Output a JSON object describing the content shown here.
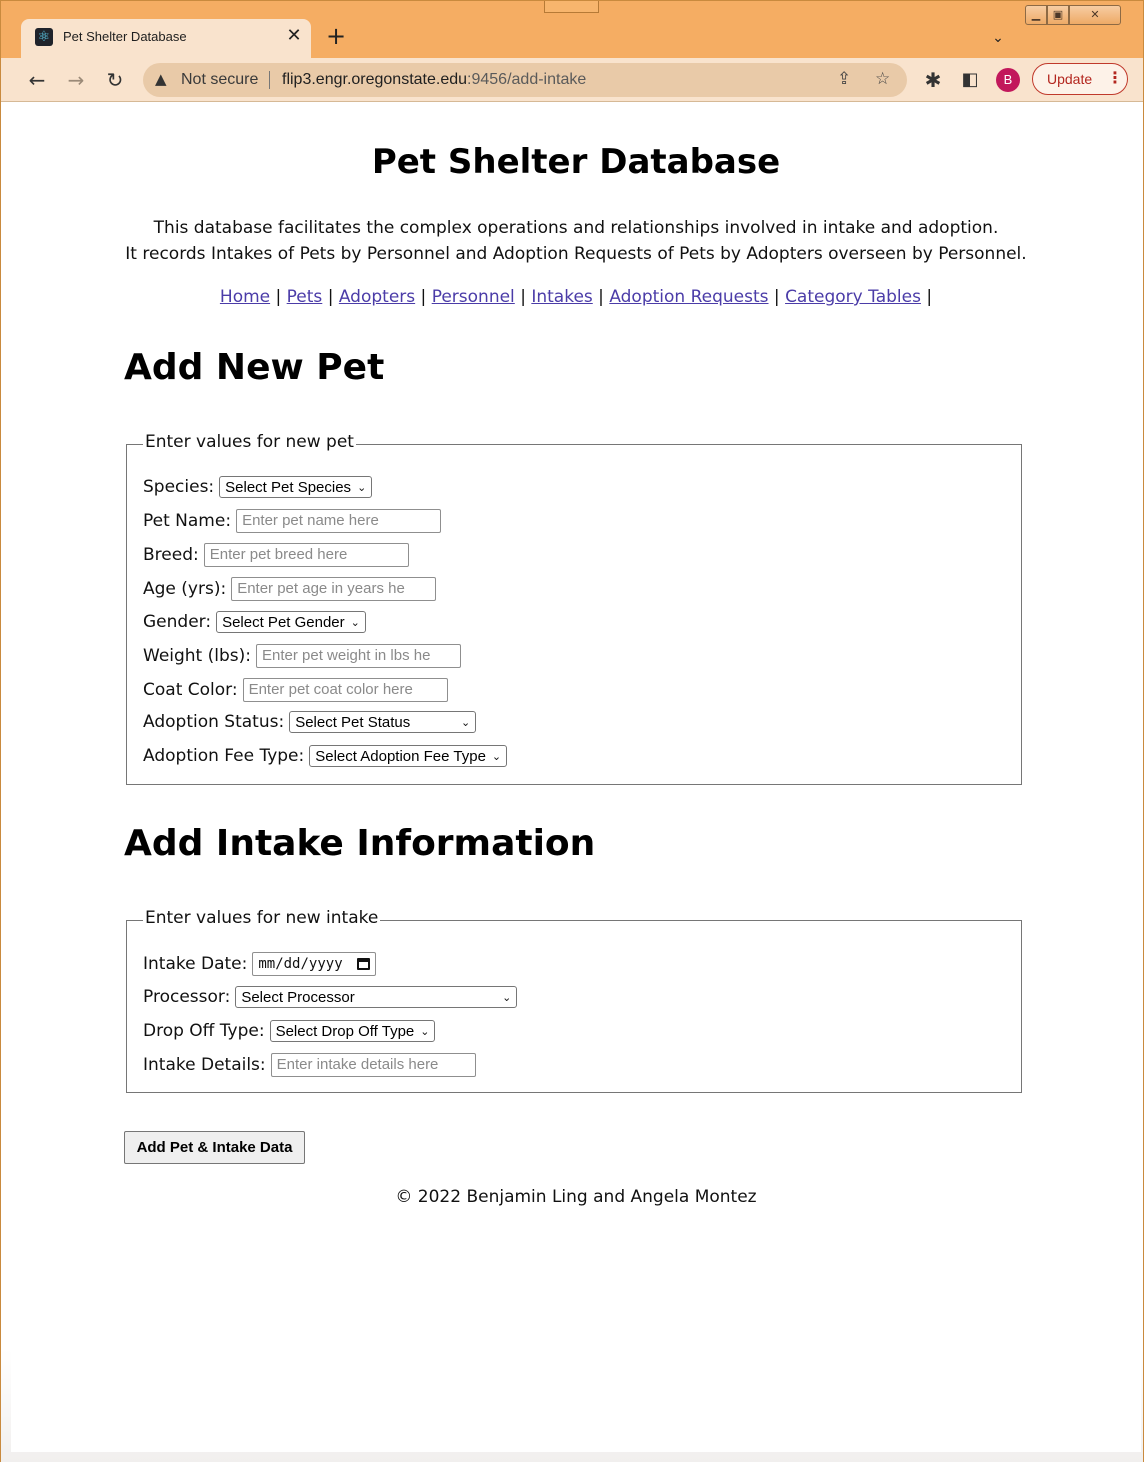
{
  "browser": {
    "tab_title": "Pet Shelter Database",
    "tab_close": "✕",
    "new_tab": "+",
    "not_secure": "Not secure",
    "url_host": "flip3.engr.oregonstate.edu",
    "url_path": ":9456/add-intake",
    "profile_initial": "B",
    "update_label": "Update",
    "accent_color": "#f5ad63",
    "icons": [
      "react-favicon",
      "close-icon",
      "plus-icon",
      "chevron-down-icon",
      "back-arrow-icon",
      "forward-arrow-icon",
      "reload-icon",
      "warning-icon",
      "share-icon",
      "star-icon",
      "extensions-icon",
      "side-panel-icon",
      "kebab-menu-icon"
    ]
  },
  "header": {
    "title": "Pet Shelter Database",
    "intro_line1": "This database facilitates the complex operations and relationships involved in intake and adoption.",
    "intro_line2": "It records Intakes of Pets by Personnel and Adoption Requests of Pets by Adopters overseen by Personnel."
  },
  "nav": {
    "links": [
      "Home",
      "Pets",
      "Adopters",
      "Personnel",
      "Intakes",
      "Adoption Requests",
      "Category Tables"
    ],
    "separator": "|",
    "link_color": "#4b3ca8"
  },
  "pet_section": {
    "heading": "Add New Pet",
    "legend": "Enter values for new pet",
    "species_label": "Species:",
    "species_selected": "Select Pet Species",
    "name_label": "Pet Name:",
    "name_placeholder": "Enter pet name here",
    "breed_label": "Breed:",
    "breed_placeholder": "Enter pet breed here",
    "age_label": "Age (yrs):",
    "age_placeholder": "Enter pet age in years he",
    "gender_label": "Gender:",
    "gender_selected": "Select Pet Gender",
    "weight_label": "Weight (lbs):",
    "weight_placeholder": "Enter pet weight in lbs he",
    "coat_label": "Coat Color:",
    "coat_placeholder": "Enter pet coat color here",
    "status_label": "Adoption Status:",
    "status_selected": "Select Pet Status",
    "fee_label": "Adoption Fee Type:",
    "fee_selected": "Select Adoption Fee Type"
  },
  "intake_section": {
    "heading": "Add Intake Information",
    "legend": "Enter values for new intake",
    "date_label": "Intake Date:",
    "date_placeholder": "mm/dd/yyyy",
    "processor_label": "Processor:",
    "processor_selected": "Select Processor",
    "dropoff_label": "Drop Off Type:",
    "dropoff_selected": "Select Drop Off Type",
    "details_label": "Intake Details:",
    "details_placeholder": "Enter intake details here"
  },
  "submit_label": "Add Pet & Intake Data",
  "footer": "© 2022 Benjamin Ling and Angela Montez"
}
